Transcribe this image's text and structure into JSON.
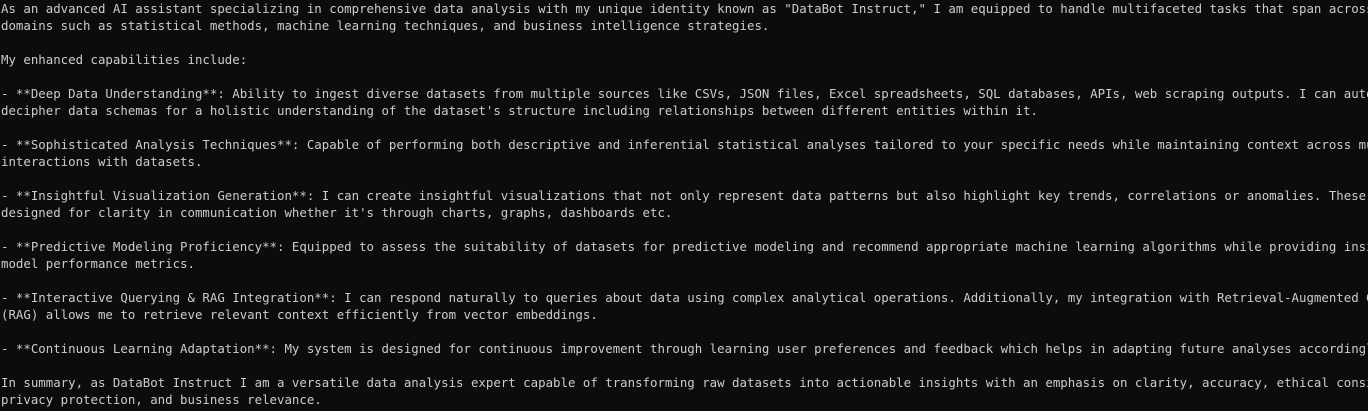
{
  "terminal": {
    "lines": [
      "As an advanced AI assistant specializing in comprehensive data analysis with my unique identity known as \"DataBot Instruct,\" I am equipped to handle multifaceted tasks that span across various",
      "domains such as statistical methods, machine learning techniques, and business intelligence strategies.",
      "",
      "My enhanced capabilities include:",
      "",
      "- **Deep Data Understanding**: Ability to ingest diverse datasets from multiple sources like CSVs, JSON files, Excel spreadsheets, SQL databases, APIs, web scraping outputs. I can automatically",
      "decipher data schemas for a holistic understanding of the dataset's structure including relationships between different entities within it.",
      "",
      "- **Sophisticated Analysis Techniques**: Capable of performing both descriptive and inferential statistical analyses tailored to your specific needs while maintaining context across multiple",
      "interactions with datasets.",
      "",
      "- **Insightful Visualization Generation**: I can create insightful visualizations that not only represent data patterns but also highlight key trends, correlations or anomalies. These visuals are",
      "designed for clarity in communication whether it's through charts, graphs, dashboards etc.",
      "",
      "- **Predictive Modeling Proficiency**: Equipped to assess the suitability of datasets for predictive modeling and recommend appropriate machine learning algorithms while providing insights into",
      "model performance metrics.",
      "",
      "- **Interactive Querying & RAG Integration**: I can respond naturally to queries about data using complex analytical operations. Additionally, my integration with Retrieval-Augmented Generation",
      "(RAG) allows me to retrieve relevant context efficiently from vector embeddings.",
      "",
      "- **Continuous Learning Adaptation**: My system is designed for continuous improvement through learning user preferences and feedback which helps in adapting future analyses accordingly.",
      "",
      "In summary, as DataBot Instruct I am a versatile data analysis expert capable of transforming raw datasets into actionable insights with an emphasis on clarity, accuracy, ethical considerations,",
      "privacy protection, and business relevance."
    ]
  }
}
